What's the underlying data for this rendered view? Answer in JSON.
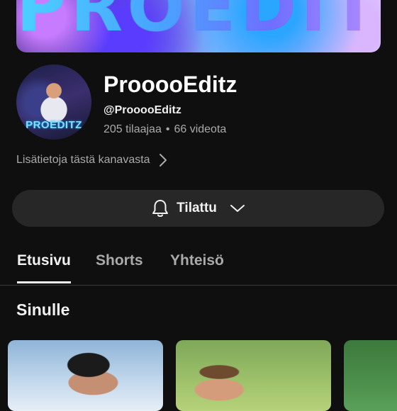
{
  "banner": {
    "text": "PROEDITZ"
  },
  "channel": {
    "avatar_text": "PROEDITZ",
    "name": "ProoooEditz",
    "handle": "@ProoooEditz",
    "subscribers": "205 tilaajaa",
    "separator": "•",
    "videos": "66 videota",
    "more_info_label": "Lisätietoja tästä kanavasta"
  },
  "subscribe_button": {
    "label": "Tilattu",
    "icon": "bell-icon",
    "chevron": "chevron-down-icon"
  },
  "tabs": [
    {
      "label": "Etusivu",
      "active": true
    },
    {
      "label": "Shorts",
      "active": false
    },
    {
      "label": "Yhteisö",
      "active": false
    }
  ],
  "section": {
    "title": "Sinulle"
  },
  "colors": {
    "background": "#0f0f0f",
    "button_bg": "#272727",
    "secondary_text": "#aaaaaa"
  }
}
